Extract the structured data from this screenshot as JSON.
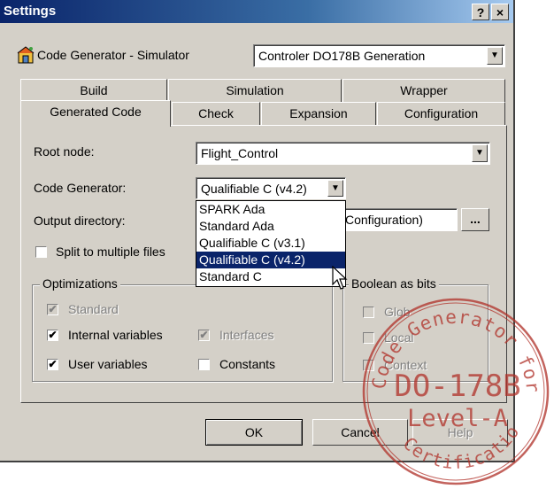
{
  "window": {
    "title": "Settings",
    "help_btn": "?",
    "close_btn": "×"
  },
  "product": {
    "name": "Code Generator - Simulator",
    "config_value": "Controler DO178B Generation"
  },
  "tabs": {
    "row1": [
      "Build",
      "Simulation",
      "Wrapper"
    ],
    "row2": [
      "Generated Code",
      "Check",
      "Expansion",
      "Configuration"
    ]
  },
  "form": {
    "root_node_label": "Root node:",
    "root_node_value": "Flight_Control",
    "code_gen_label": "Code Generator:",
    "code_gen_value": "Qualifiable C (v4.2)",
    "output_dir_label": "Output directory:",
    "output_dir_value": "Configuration)",
    "browse": "...",
    "split_label": "Split to multiple files"
  },
  "dropdown": [
    "SPARK Ada",
    "Standard Ada",
    "Qualifiable C (v3.1)",
    "Qualifiable C (v4.2)",
    "Standard C"
  ],
  "optimizations": {
    "title": "Optimizations",
    "standard": "Standard",
    "internal": "Internal variables",
    "interfaces": "Interfaces",
    "user": "User variables",
    "constants": "Constants"
  },
  "boolean": {
    "title": "Boolean as bits",
    "global": "Glob",
    "local": "Local",
    "context": "Context"
  },
  "buttons": {
    "ok": "OK",
    "cancel": "Cancel",
    "help": "Help"
  },
  "stamp": {
    "top_arc": "Code Generator for",
    "line1": "DO-178B",
    "line2": "Level-A",
    "bottom_arc": "Certification",
    "color": "#b03028"
  }
}
